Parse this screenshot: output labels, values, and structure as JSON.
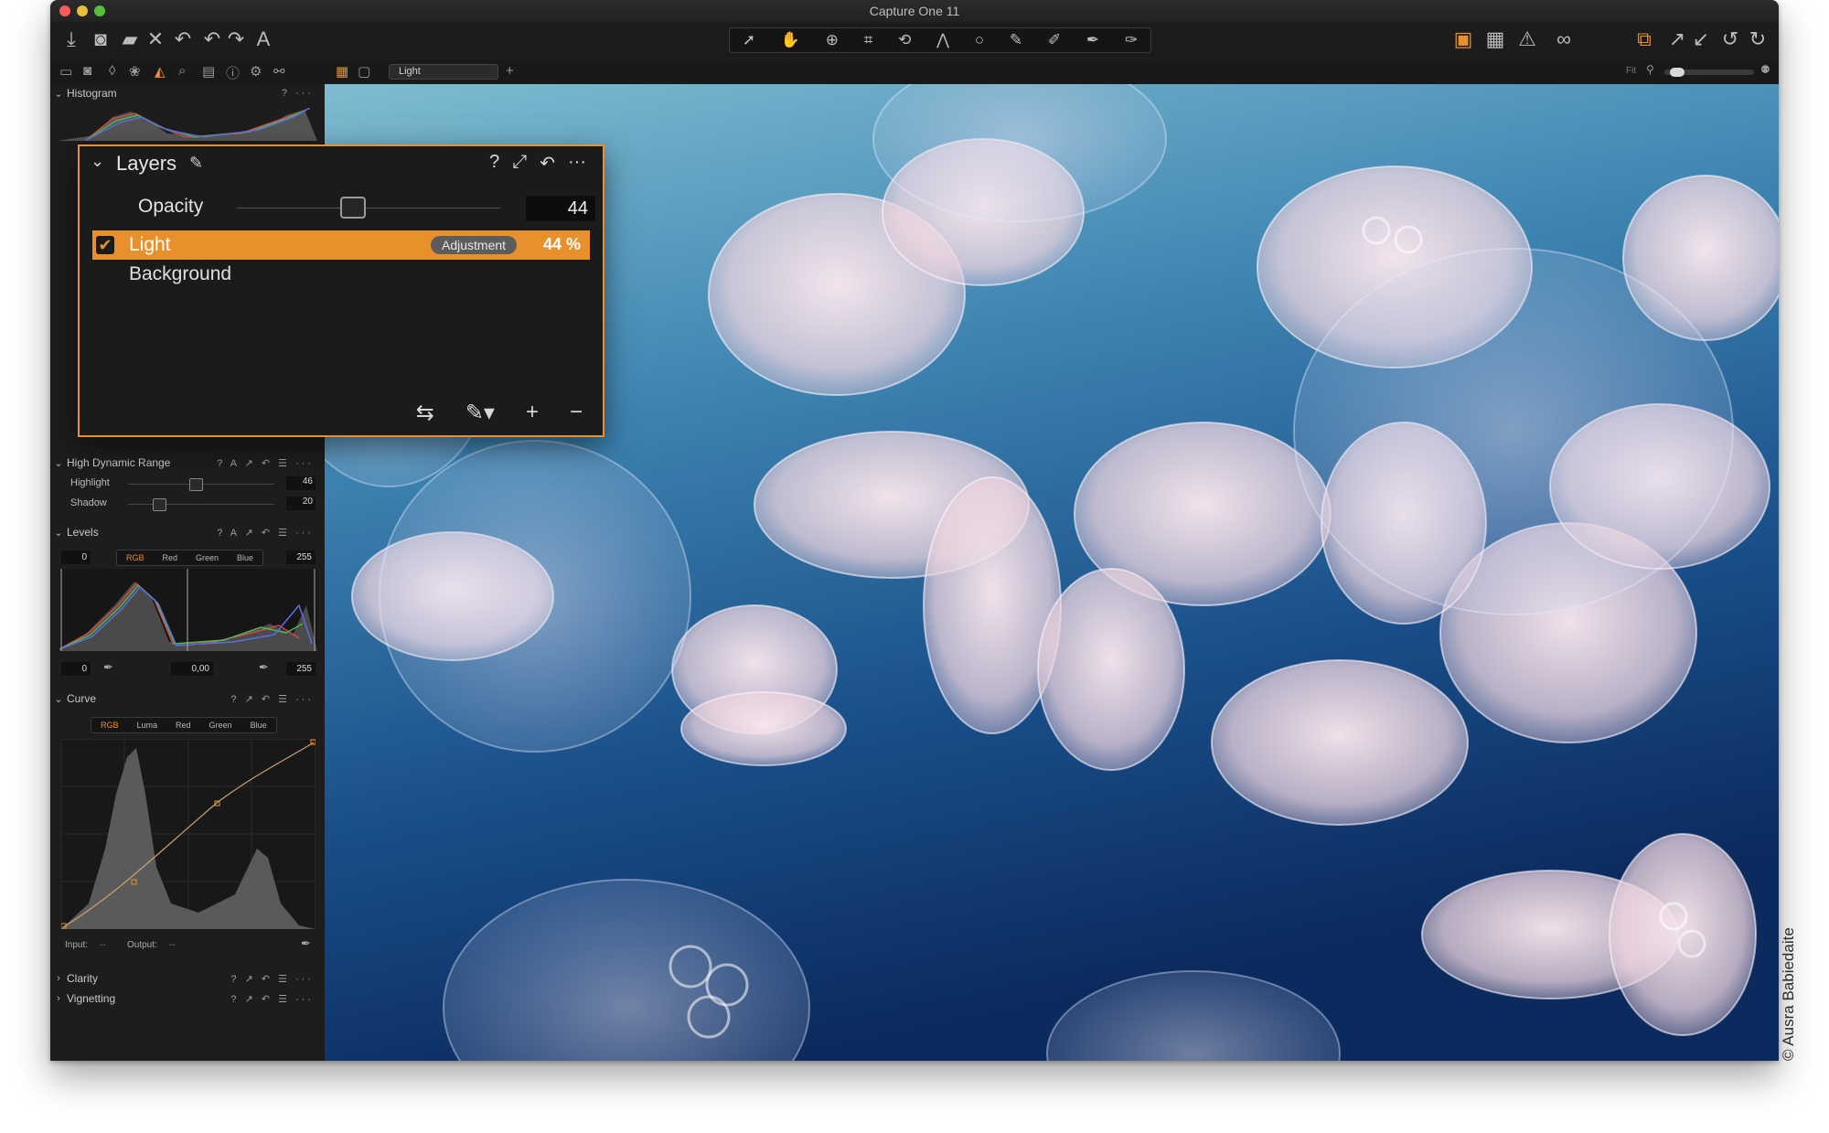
{
  "window": {
    "title": "Capture One 11"
  },
  "toolbar": {
    "left_icons": [
      "import-icon",
      "camera-icon",
      "folder-icon",
      "close-icon",
      "undo-icon",
      "undo-icon",
      "redo-icon",
      "text-icon"
    ],
    "cursor_tools": [
      "pointer-icon",
      "hand-icon",
      "zoom-icon",
      "crop-icon",
      "rotate-icon",
      "keystone-icon",
      "spot-icon",
      "brush-icon",
      "eraser-icon",
      "picker-icon",
      "wand-icon"
    ],
    "right_icons": [
      "edit-icon",
      "grid-icon",
      "warning-icon",
      "glasses-icon",
      "stack-icon",
      "expand-icon",
      "collapse-icon",
      "rotate-left-icon",
      "rotate-right-icon"
    ]
  },
  "subbar": {
    "variant_name": "Light",
    "fit_label": "Fit"
  },
  "panel": {
    "histogram": {
      "title": "Histogram"
    },
    "hdr": {
      "title": "High Dynamic Range",
      "rows": [
        {
          "label": "Highlight",
          "value": "46"
        },
        {
          "label": "Shadow",
          "value": "20"
        }
      ]
    },
    "levels": {
      "title": "Levels",
      "channels": [
        "RGB",
        "Red",
        "Green",
        "Blue"
      ],
      "input_low": "0",
      "input_high": "255",
      "output_low": "0",
      "midpoint": "0,00",
      "output_high": "255"
    },
    "curve": {
      "title": "Curve",
      "channels": [
        "RGB",
        "Luma",
        "Red",
        "Green",
        "Blue"
      ],
      "input_label": "Input:",
      "input_value": "--",
      "output_label": "Output:",
      "output_value": "--"
    },
    "clarity": {
      "title": "Clarity"
    },
    "vignetting": {
      "title": "Vignetting"
    }
  },
  "layers": {
    "title": "Layers",
    "opacity_label": "Opacity",
    "opacity_value": "44",
    "opacity_level": 44,
    "items": [
      {
        "name": "Light",
        "badge": "Adjustment",
        "percent": "44 %",
        "checked": true
      },
      {
        "name": "Background"
      }
    ]
  },
  "colors": {
    "accent": "#e8902b",
    "panel": "#1d1d1d",
    "window": "#1e1e1e"
  },
  "credit": "© Ausra Babiedaite"
}
